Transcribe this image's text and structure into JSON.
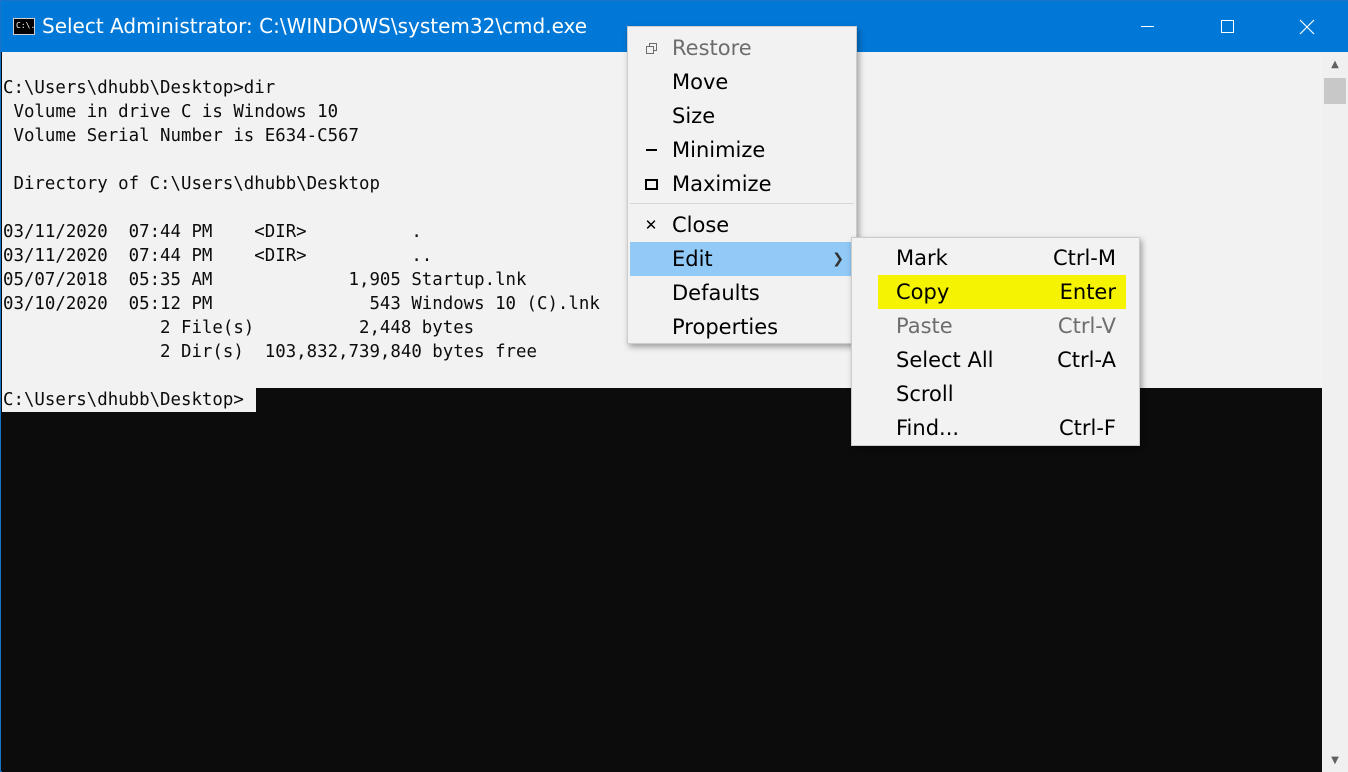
{
  "window": {
    "title": "Select Administrator: C:\\WINDOWS\\system32\\cmd.exe",
    "icon_text": "C:\\."
  },
  "console": {
    "lines": [
      "C:\\Users\\dhubb\\Desktop>dir",
      " Volume in drive C is Windows 10",
      " Volume Serial Number is E634-C567",
      "",
      " Directory of C:\\Users\\dhubb\\Desktop",
      "",
      "03/11/2020  07:44 PM    <DIR>          .",
      "03/11/2020  07:44 PM    <DIR>          ..",
      "05/07/2018  05:35 AM             1,905 Startup.lnk",
      "03/10/2020  05:12 PM               543 Windows 10 (C).lnk",
      "               2 File(s)          2,448 bytes",
      "               2 Dir(s)  103,832,739,840 bytes free",
      "",
      "C:\\Users\\dhubb\\Desktop>"
    ]
  },
  "system_menu": {
    "restore": "Restore",
    "move": "Move",
    "size": "Size",
    "minimize": "Minimize",
    "maximize": "Maximize",
    "close": "Close",
    "edit": "Edit",
    "defaults": "Defaults",
    "properties": "Properties"
  },
  "edit_menu": {
    "items": [
      {
        "label": "Mark",
        "shortcut": "Ctrl-M"
      },
      {
        "label": "Copy",
        "shortcut": "Enter"
      },
      {
        "label": "Paste",
        "shortcut": "Ctrl-V"
      },
      {
        "label": "Select All",
        "shortcut": "Ctrl-A"
      },
      {
        "label": "Scroll",
        "shortcut": ""
      },
      {
        "label": "Find...",
        "shortcut": "Ctrl-F"
      }
    ]
  },
  "colors": {
    "titlebar": "#0078d7",
    "menu_hover": "#91c9f7",
    "copy_highlight": "#f5f300",
    "console_bg": "#0c0c0c",
    "selection_bg": "#f2f2f2"
  },
  "icons": {
    "app": "cmd-icon",
    "minimize": "minimize-icon",
    "maximize": "maximize-icon",
    "close": "close-icon",
    "submenu": "chevron-right-icon"
  }
}
